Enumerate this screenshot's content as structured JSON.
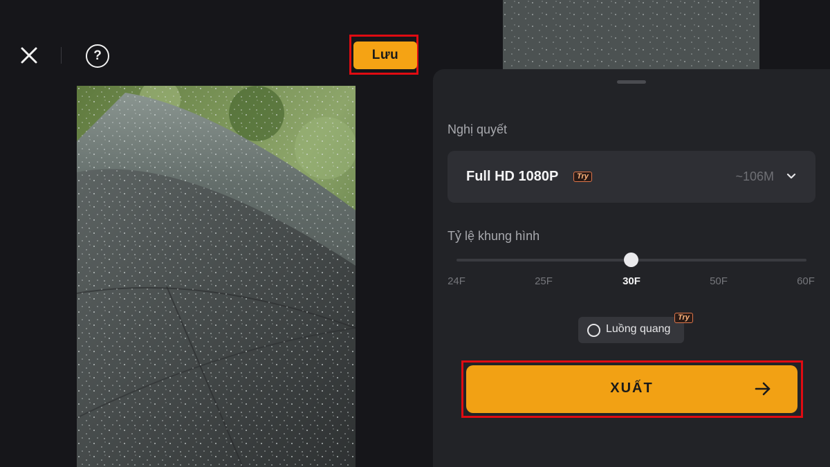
{
  "toolbar": {
    "save_label": "Lưu",
    "close_icon": "close-icon",
    "help_icon": "question-icon",
    "help_glyph": "?"
  },
  "export_panel": {
    "resolution_label": "Nghị quyết",
    "resolution_value": "Full HD 1080P",
    "resolution_badge": "Try",
    "estimated_size": "~106M",
    "frame_rate_label": "Tỷ lệ khung hình",
    "frame_rate_options": [
      "24F",
      "25F",
      "30F",
      "50F",
      "60F"
    ],
    "frame_rate_selected": "30F",
    "optical_flow_label": "Luồng quang",
    "optical_flow_badge": "Try",
    "optical_flow_checked": false,
    "export_label": "XUẤT"
  },
  "colors": {
    "accent": "#f5a314",
    "highlight_box": "#e00b12",
    "panel_bg": "#222327",
    "page_bg": "#16161a"
  }
}
